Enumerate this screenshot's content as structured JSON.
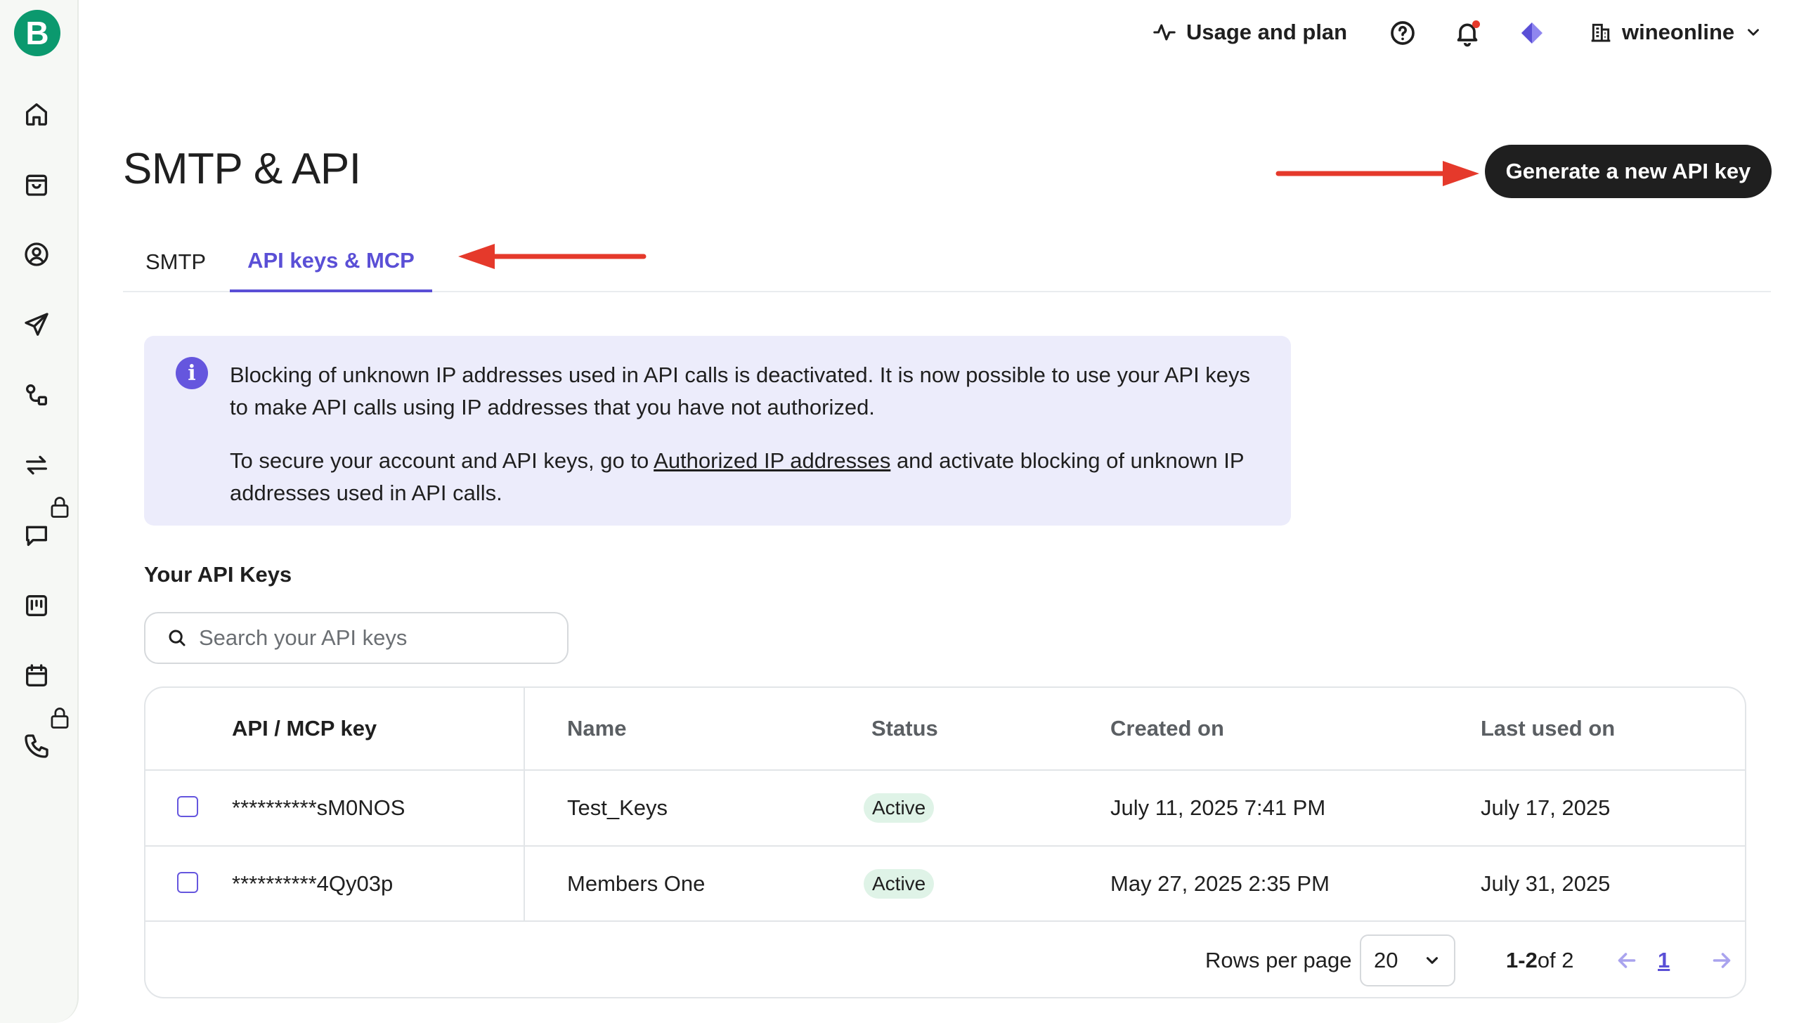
{
  "sidebar": {
    "logo_letter": "B",
    "items": [
      {
        "name": "home-icon"
      },
      {
        "name": "shopping-bag-icon"
      },
      {
        "name": "contacts-icon"
      },
      {
        "name": "campaigns-icon"
      },
      {
        "name": "automations-icon"
      },
      {
        "name": "transactional-icon"
      },
      {
        "name": "conversations-icon",
        "locked": true
      },
      {
        "name": "deals-icon"
      },
      {
        "name": "meetings-icon"
      },
      {
        "name": "phone-icon",
        "locked": true
      }
    ]
  },
  "topbar": {
    "usage_label": "Usage and plan",
    "account_name": "wineonline"
  },
  "page": {
    "title": "SMTP & API",
    "generate_button": "Generate a new API key"
  },
  "tabs": [
    {
      "label": "SMTP",
      "active": false
    },
    {
      "label": "API keys & MCP",
      "active": true
    }
  ],
  "banner": {
    "line1": "Blocking of unknown IP addresses used in API calls is deactivated. It is now possible to use your API keys to make API calls using IP addresses that you have not authorized.",
    "line2_prefix": "To secure your account and API keys, go to ",
    "line2_link": "Authorized IP addresses",
    "line2_suffix": " and activate blocking of unknown IP addresses used in API calls."
  },
  "keys_section": {
    "title": "Your API Keys",
    "search_placeholder": "Search your API keys"
  },
  "table": {
    "headers": [
      "API / MCP key",
      "Name",
      "Status",
      "Created on",
      "Last used on"
    ],
    "rows": [
      {
        "key": "**********sM0NOS",
        "name": "Test_Keys",
        "status": "Active",
        "created": "July 11, 2025 7:41 PM",
        "last_used": "July 17, 2025"
      },
      {
        "key": "**********4Qy03p",
        "name": "Members One",
        "status": "Active",
        "created": "May 27, 2025 2:35 PM",
        "last_used": "July 31, 2025"
      }
    ],
    "footer": {
      "rows_per_page_label": "Rows per page",
      "rows_per_page_value": "20",
      "range_bold": "1-2",
      "range_rest": " of 2",
      "current_page": "1"
    }
  },
  "colors": {
    "accent": "#5a4fd6",
    "brand": "#0b996e",
    "annotation_arrow": "#e5392b",
    "status_active_bg": "#dff3e7"
  }
}
